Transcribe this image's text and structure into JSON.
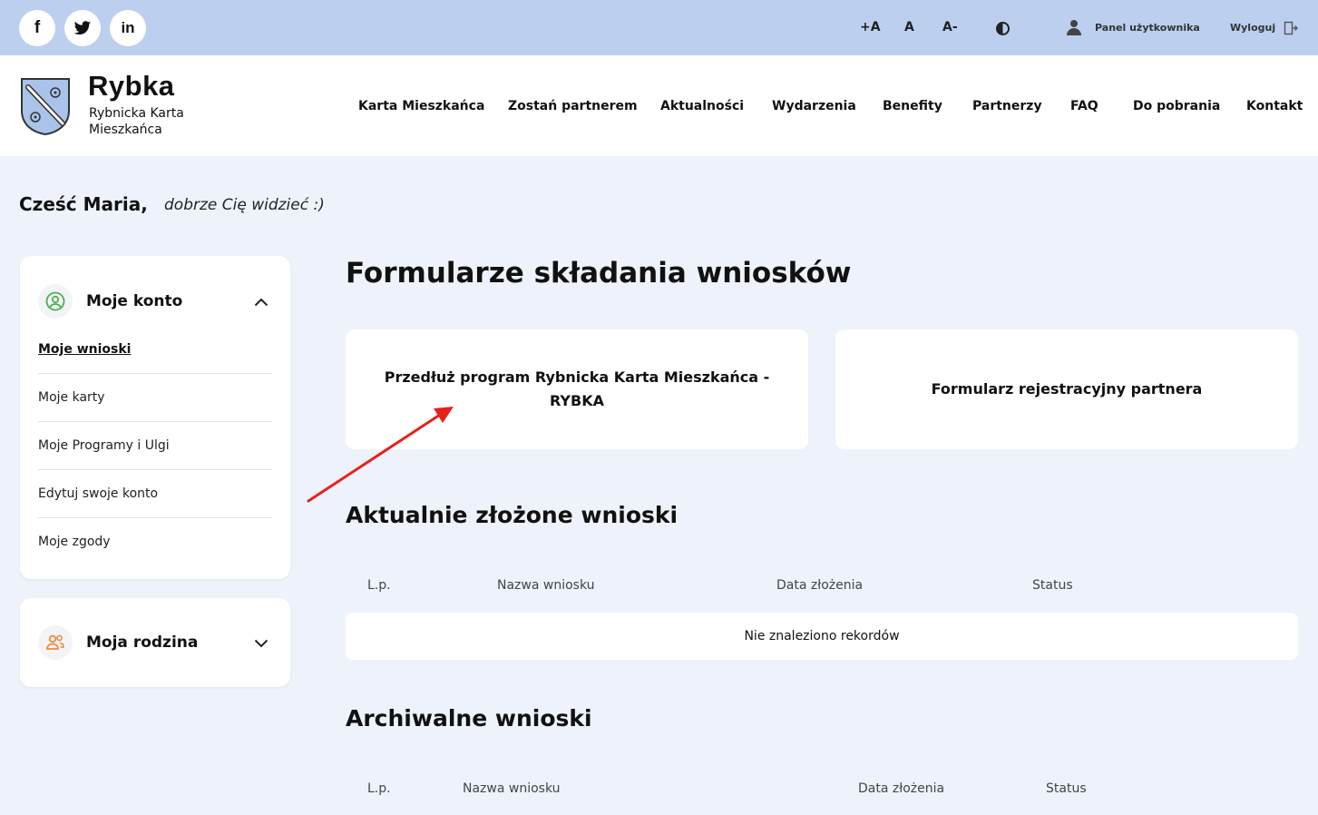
{
  "social": {
    "facebook": "f",
    "linkedin": "in"
  },
  "topbar": {
    "font_increase": "+A",
    "font_normal": "A",
    "font_decrease": "A-",
    "user_panel": "Panel użytkownika",
    "logout": "Wyloguj"
  },
  "brand": {
    "name": "Rybka",
    "subtitle": "Rybnicka Karta Mieszkańca"
  },
  "nav": [
    "Karta Mieszkańca",
    "Zostań partnerem",
    "Aktualności",
    "Wydarzenia",
    "Benefity",
    "Partnerzy",
    "FAQ",
    "Do pobrania",
    "Kontakt"
  ],
  "greeting": {
    "hello": "Cześć Maria,",
    "sub": "dobrze Cię widzieć :)"
  },
  "sidebar": {
    "account_title": "Moje konto",
    "items": [
      "Moje wnioski",
      "Moje karty",
      "Moje Programy i Ulgi",
      "Edytuj swoje konto",
      "Moje zgody"
    ],
    "family_title": "Moja rodzina"
  },
  "main": {
    "title": "Formularze składania wniosków",
    "tiles": [
      "Przedłuż program Rybnicka Karta Mieszkańca - RYBKA",
      "Formularz rejestracyjny partnera"
    ],
    "current_title": "Aktualnie złożone wnioski",
    "current_headers": [
      "L.p.",
      "Nazwa wniosku",
      "Data złożenia",
      "Status"
    ],
    "empty_text": "Nie znaleziono rekordów",
    "archive_title": "Archiwalne wnioski",
    "archive_headers": [
      "L.p.",
      "Nazwa wniosku",
      "Data złożenia",
      "Status"
    ]
  },
  "colors": {
    "topbar": "#bccfef",
    "page_bg": "#eef2fb",
    "annotation_arrow": "#e8201c",
    "account_icon": "#4caf50",
    "family_icon": "#f08a3c"
  }
}
